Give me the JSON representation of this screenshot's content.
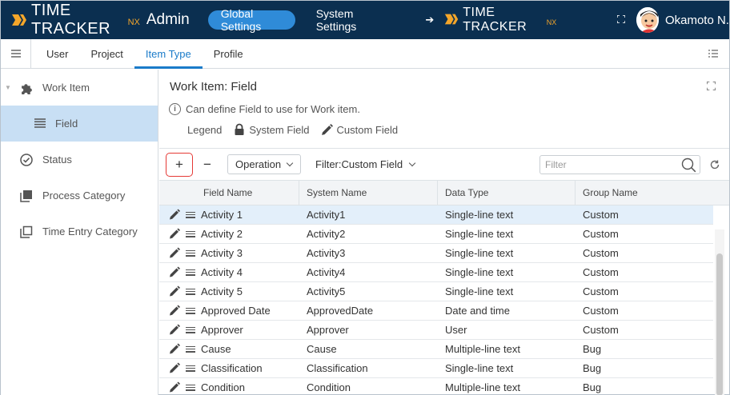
{
  "app": {
    "logo_text": "TIME TRACKER",
    "logo_suffix": "NX",
    "logo_admin": "Admin",
    "top_buttons": [
      "Global Settings",
      "System Settings"
    ],
    "user_name": "Okamoto N."
  },
  "nav": {
    "tabs": [
      "User",
      "Project",
      "Item Type",
      "Profile"
    ],
    "active_tab": "Item Type"
  },
  "sidebar": {
    "items": [
      {
        "label": "Work Item",
        "icon": "puzzle-icon"
      },
      {
        "label": "Field",
        "icon": "list-icon"
      },
      {
        "label": "Status",
        "icon": "check-circle-icon"
      },
      {
        "label": "Process Category",
        "icon": "stack-icon"
      },
      {
        "label": "Time Entry Category",
        "icon": "copy-icon"
      }
    ]
  },
  "main": {
    "title": "Work Item: Field",
    "description": "Can define Field to use for Work item.",
    "legend_label": "Legend",
    "legend_system": "System Field",
    "legend_custom": "Custom Field"
  },
  "toolbar": {
    "add_label": "+",
    "remove_label": "−",
    "operation_label": "Operation",
    "filter_label": "Filter:Custom Field",
    "search_placeholder": "Filter"
  },
  "table": {
    "columns": [
      "Field Name",
      "System Name",
      "Data Type",
      "Group Name"
    ],
    "rows": [
      [
        "Activity 1",
        "Activity1",
        "Single-line text",
        "Custom"
      ],
      [
        "Activity 2",
        "Activity2",
        "Single-line text",
        "Custom"
      ],
      [
        "Activity 3",
        "Activity3",
        "Single-line text",
        "Custom"
      ],
      [
        "Activity 4",
        "Activity4",
        "Single-line text",
        "Custom"
      ],
      [
        "Activity 5",
        "Activity5",
        "Single-line text",
        "Custom"
      ],
      [
        "Approved Date",
        "ApprovedDate",
        "Date and time",
        "Custom"
      ],
      [
        "Approver",
        "Approver",
        "User",
        "Custom"
      ],
      [
        "Cause",
        "Cause",
        "Multiple-line text",
        "Bug"
      ],
      [
        "Classification",
        "Classification",
        "Single-line text",
        "Bug"
      ],
      [
        "Condition",
        "Condition",
        "Multiple-line text",
        "Bug"
      ]
    ]
  },
  "colors": {
    "topbar": "#0b2f50",
    "accent": "#2f8bd8",
    "logo_orange": "#f4a62a",
    "selected_row": "#e3effa",
    "sidebar_selected": "#c8dff4",
    "add_button_border": "#e53935"
  }
}
